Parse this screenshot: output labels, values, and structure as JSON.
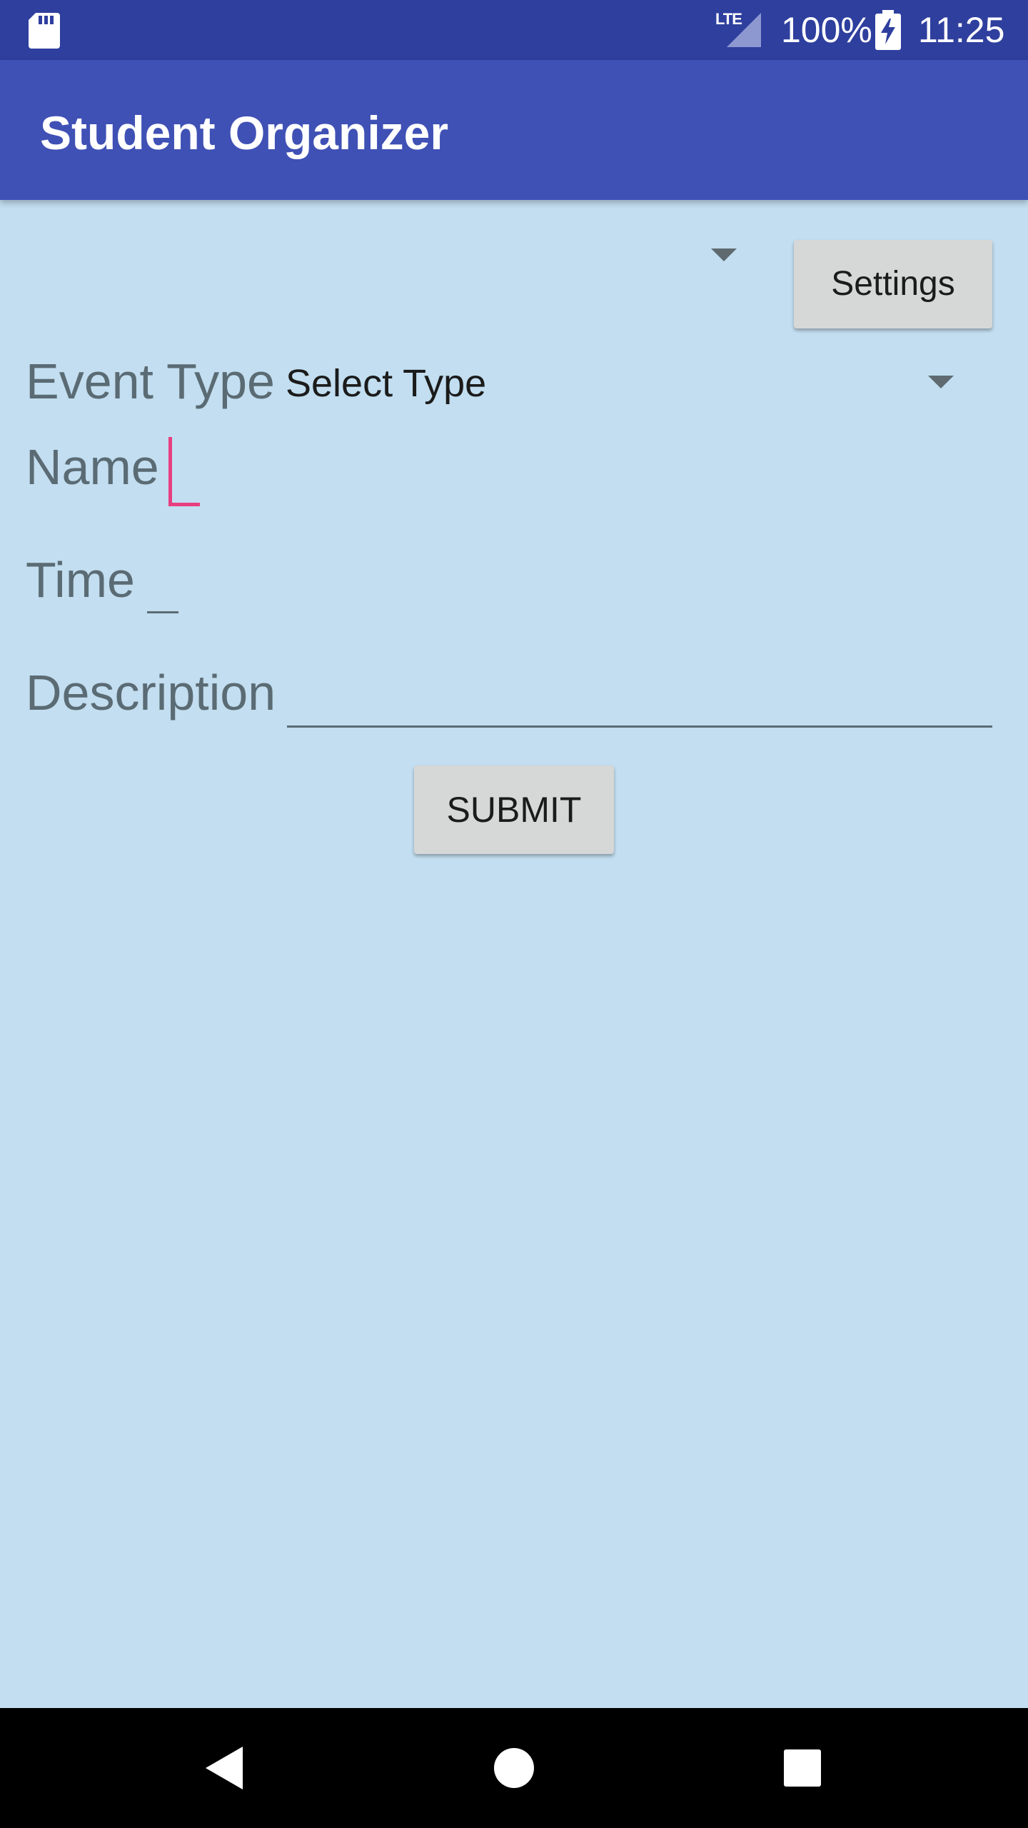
{
  "status_bar": {
    "network_label": "LTE",
    "battery_percent": "100%",
    "time": "11:25",
    "icons": [
      "sd-card-icon",
      "lte-signal-icon",
      "battery-charging-icon"
    ]
  },
  "app_bar": {
    "title": "Student Organizer"
  },
  "top_spinner": {
    "selected": "",
    "icon": "dropdown-caret-icon"
  },
  "settings_button": {
    "label": "Settings"
  },
  "form": {
    "event_type": {
      "label": "Event Type",
      "selected": "Select Type"
    },
    "name": {
      "label": "Name",
      "value": ""
    },
    "time": {
      "label": "Time",
      "value": ""
    },
    "description": {
      "label": "Description",
      "value": ""
    },
    "submit_label": "SUBMIT"
  },
  "nav_bar": {
    "icons": [
      "back-icon",
      "home-icon",
      "recents-icon"
    ]
  },
  "colors": {
    "status_bar": "#2f3f9e",
    "app_bar": "#3f51b5",
    "background": "#c2def0",
    "accent": "#e83e80",
    "button": "#d6d7d7",
    "label_text": "#5b6b74"
  }
}
